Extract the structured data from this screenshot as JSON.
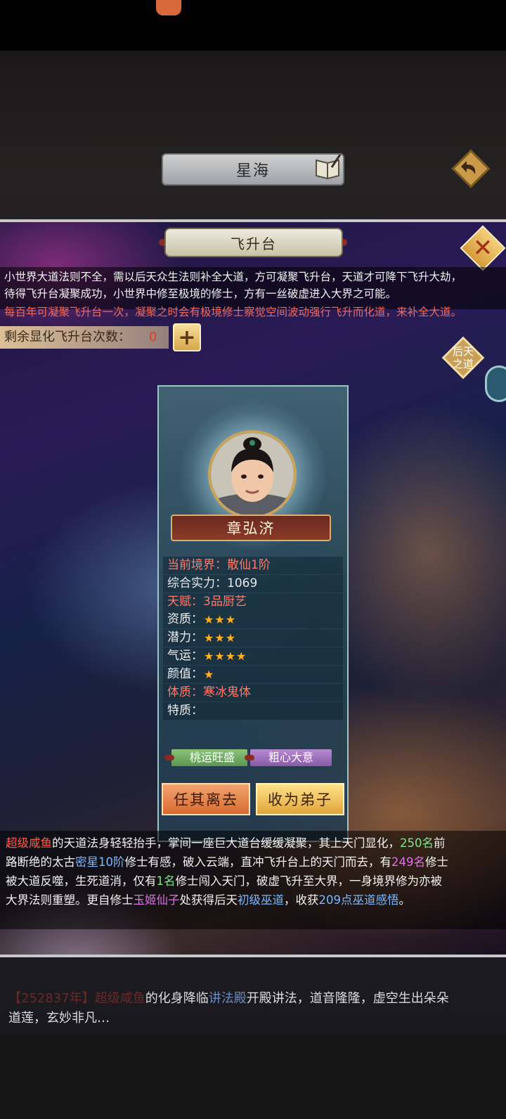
{
  "header": {
    "location_title": "星海"
  },
  "panel": {
    "title": "飞升台",
    "desc_line1": "小世界大道法则不全，需以后天众生法则补全大道，方可凝聚飞升台，天道才可降下飞升大劫，",
    "desc_line2": "待得飞升台凝聚成功，小世界中修至极境的修士，方有一丝破虚进入大界之可能。",
    "desc_line3": "每百年可凝聚飞升台一次，凝聚之时会有极境修士察觉空间波动强行飞升而化道，来补全大道。",
    "remaining_label": "剩余显化飞升台次数：",
    "remaining_count": "0",
    "add_symbol": "+",
    "houtian_line1": "后天",
    "houtian_line2": "之道"
  },
  "character": {
    "name": "章弘济",
    "stats": [
      {
        "label": "当前境界：散仙1阶",
        "stars": ""
      },
      {
        "label": "综合实力：1069",
        "stars": ""
      },
      {
        "label": "天赋：3品厨艺",
        "stars": ""
      },
      {
        "label": "资质：",
        "stars": "★★★"
      },
      {
        "label": "潜力：",
        "stars": "★★★"
      },
      {
        "label": "气运：",
        "stars": "★★★★"
      },
      {
        "label": "颜值：",
        "stars": "★"
      },
      {
        "label": "体质：寒冰鬼体",
        "stars": ""
      },
      {
        "label": "特质：",
        "stars": ""
      }
    ],
    "traits": [
      "桃运旺盛",
      "粗心大意"
    ],
    "dismiss_label": "任其离去",
    "accept_label": "收为弟子"
  },
  "result": {
    "l1": [
      "超级咸鱼",
      "的天道法身轻轻抬手，掌间一座巨大道台缓缓凝聚，其上天门显化，",
      "250名",
      "前"
    ],
    "l2": [
      "路断绝的太古",
      "密星10阶",
      "修士有感，破入云端，直冲飞升台上的天门而去，有",
      "249名",
      "修士"
    ],
    "l3": [
      "被大道反噬，生死道消，仅有",
      "1名",
      "修士闯入天门，破虚飞升至大界，一身境界修为亦被"
    ],
    "l4": [
      "大界法则重塑。更自修士",
      "玉姬仙子",
      "处获得后天",
      "初级巫道",
      "，收获",
      "209点巫道感悟",
      "。"
    ]
  },
  "log": {
    "year": "【252837年】",
    "actor": "超级咸鱼",
    "t1": "的化身降临",
    "place": "讲法殿",
    "t2": "开殿讲法，道音隆隆，虚空生出朵朵",
    "line2": "道莲，玄妙非凡…"
  },
  "colors": {
    "red": "#ff5a4a",
    "green": "#7ae88a",
    "blue": "#7ab8ff",
    "purple": "#e070e8",
    "star": "#ffb020"
  }
}
